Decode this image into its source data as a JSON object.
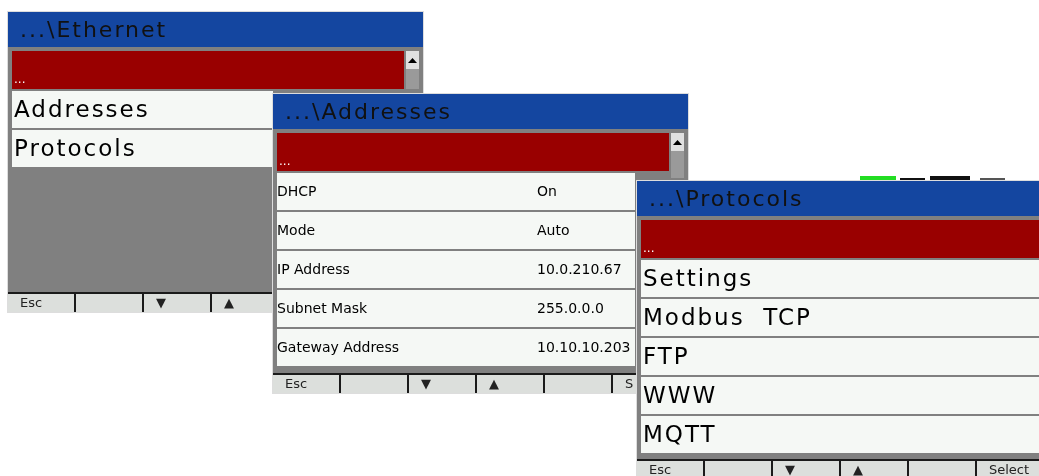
{
  "windows": [
    {
      "kind": "menu",
      "title": "...\\Ethernet",
      "rows": [
        {
          "label": "...",
          "selected": true
        },
        {
          "label": "Addresses",
          "selected": false
        },
        {
          "label": "Protocols",
          "selected": false
        }
      ],
      "softkeys": [
        {
          "kind": "label",
          "label": "Esc"
        },
        {
          "kind": "blank"
        },
        {
          "kind": "label",
          "label": "▼"
        },
        {
          "kind": "label",
          "label": "▲"
        }
      ]
    },
    {
      "kind": "values",
      "title": "...\\Addresses",
      "rows": [
        {
          "label": "...",
          "selected": true
        },
        {
          "label": "DHCP",
          "value": "On",
          "selected": false
        },
        {
          "label": "Mode",
          "value": "Auto",
          "selected": false
        },
        {
          "label": "IP Address",
          "value": "10.0.210.67",
          "selected": false
        },
        {
          "label": "Subnet Mask",
          "value": "255.0.0.0",
          "selected": false
        },
        {
          "label": "Gateway Address",
          "value": "10.10.10.203",
          "selected": false
        }
      ],
      "softkeys": [
        {
          "kind": "label",
          "label": "Esc"
        },
        {
          "kind": "blank"
        },
        {
          "kind": "label",
          "label": "▼"
        },
        {
          "kind": "label",
          "label": "▲"
        },
        {
          "kind": "blank"
        },
        {
          "kind": "label",
          "label": "S"
        }
      ]
    },
    {
      "kind": "menu",
      "title": "...\\Protocols",
      "rows": [
        {
          "label": "...",
          "selected": true
        },
        {
          "label": "Settings",
          "selected": false
        },
        {
          "label": "Modbus  TCP",
          "selected": false
        },
        {
          "label": "FTP",
          "selected": false
        },
        {
          "label": "WWW",
          "selected": false
        },
        {
          "label": "MQTT",
          "selected": false
        }
      ],
      "softkeys": [
        {
          "kind": "label",
          "label": "Esc"
        },
        {
          "kind": "blank"
        },
        {
          "kind": "label",
          "label": "▼"
        },
        {
          "kind": "label",
          "label": "▲"
        },
        {
          "kind": "blank"
        },
        {
          "kind": "label",
          "label": "Select"
        }
      ]
    }
  ]
}
